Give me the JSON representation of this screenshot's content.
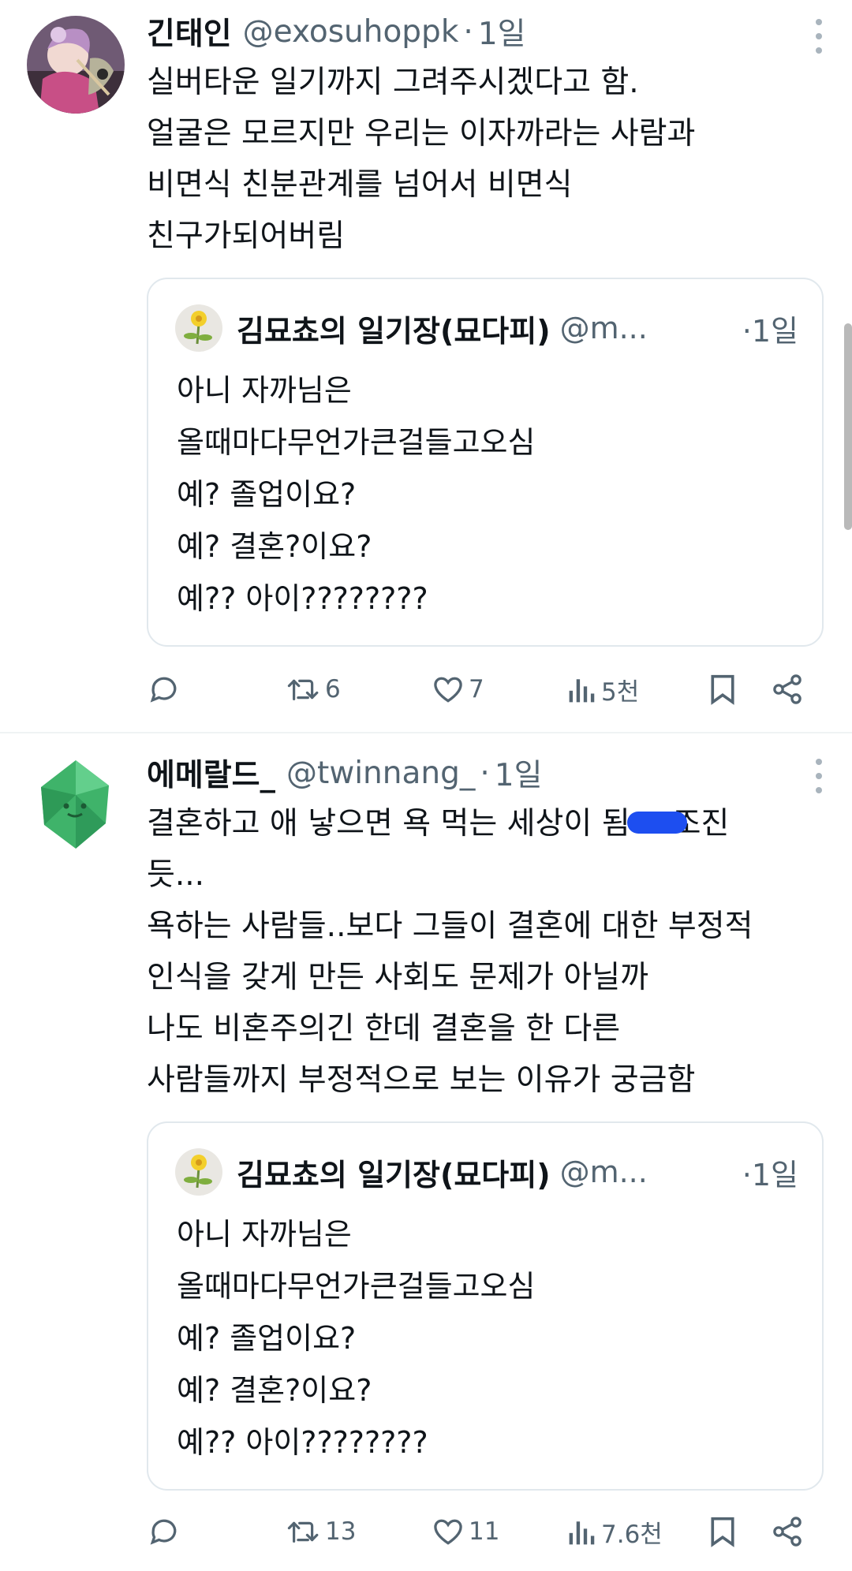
{
  "tweets": [
    {
      "display_name": "긴태인",
      "handle": "@exosuhoppk",
      "separator": "·",
      "time": "1일",
      "lines": [
        "실버타운 일기까지 그려주시겠다고 함.",
        "얼굴은 모르지만 우리는 이자까라는 사람과",
        "비면식 친분관계를 넘어서 비면식",
        "친구가되어버림"
      ],
      "quote": {
        "display_name": "김묘쵸의 일기장(묘다피)",
        "handle": "@m...",
        "time": "·1일",
        "lines": [
          "아니 자까님은",
          "올때마다무언가큰걸들고오심",
          "예? 졸업이요?",
          "예? 결혼?이요?",
          "예?? 아이????????"
        ]
      },
      "stats": {
        "reply": "",
        "retweet": "6",
        "like": "7",
        "views": "5천"
      }
    },
    {
      "display_name": "에메랄드_",
      "handle": "@twinnang_",
      "separator": "·",
      "time": "1일",
      "line1_before": "결혼하고 애 낳으면 욕 먹는 세상이 됨",
      "line1_after": "조진",
      "lines": [
        "듯...",
        "욕하는 사람들..보다 그들이 결혼에 대한 부정적",
        "인식을 갖게 만든 사회도 문제가 아닐까",
        "나도 비혼주의긴 한데 결혼을 한 다른",
        "사람들까지 부정적으로 보는 이유가 궁금함"
      ],
      "quote": {
        "display_name": "김묘쵸의 일기장(묘다피)",
        "handle": "@m...",
        "time": "·1일",
        "lines": [
          "아니 자까님은",
          "올때마다무언가큰걸들고오심",
          "예? 졸업이요?",
          "예? 결혼?이요?",
          "예?? 아이????????"
        ]
      },
      "stats": {
        "reply": "",
        "retweet": "13",
        "like": "11",
        "views": "7.6천"
      }
    }
  ]
}
